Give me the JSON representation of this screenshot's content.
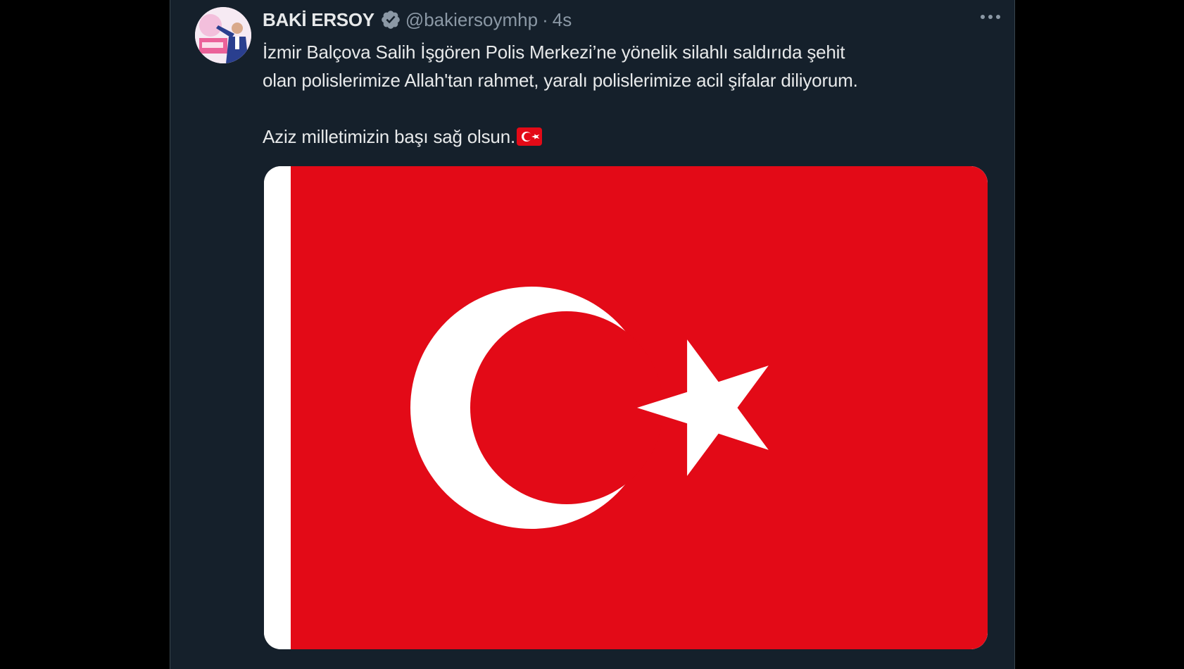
{
  "tweet": {
    "author": {
      "display_name": "BAKİ ERSOY",
      "handle": "@bakiersoymhp",
      "verified": true
    },
    "separator": "·",
    "timestamp": "4s",
    "text": {
      "line1": "İzmir Balçova Salih İşgören Polis Merkezi’ne yönelik silahlı saldırıda şehit",
      "line2": "olan polislerimize Allah'tan rahmet, yaralı polislerimize acil şifalar diliyorum.",
      "line3": "Aziz milletimizin başı sağ olsun."
    },
    "emoji": "turkey-flag-emoji",
    "media": {
      "type": "image",
      "subject": "turkey-flag",
      "colors": {
        "red": "#e30a17",
        "white": "#ffffff"
      }
    }
  },
  "icons": {
    "verified": "verified-badge-icon",
    "more": "more-options-icon"
  },
  "theme": {
    "background": "#15202b",
    "outer": "#000000",
    "text_primary": "#e7e9ea",
    "text_secondary": "#8b98a5",
    "border": "#38444d"
  }
}
